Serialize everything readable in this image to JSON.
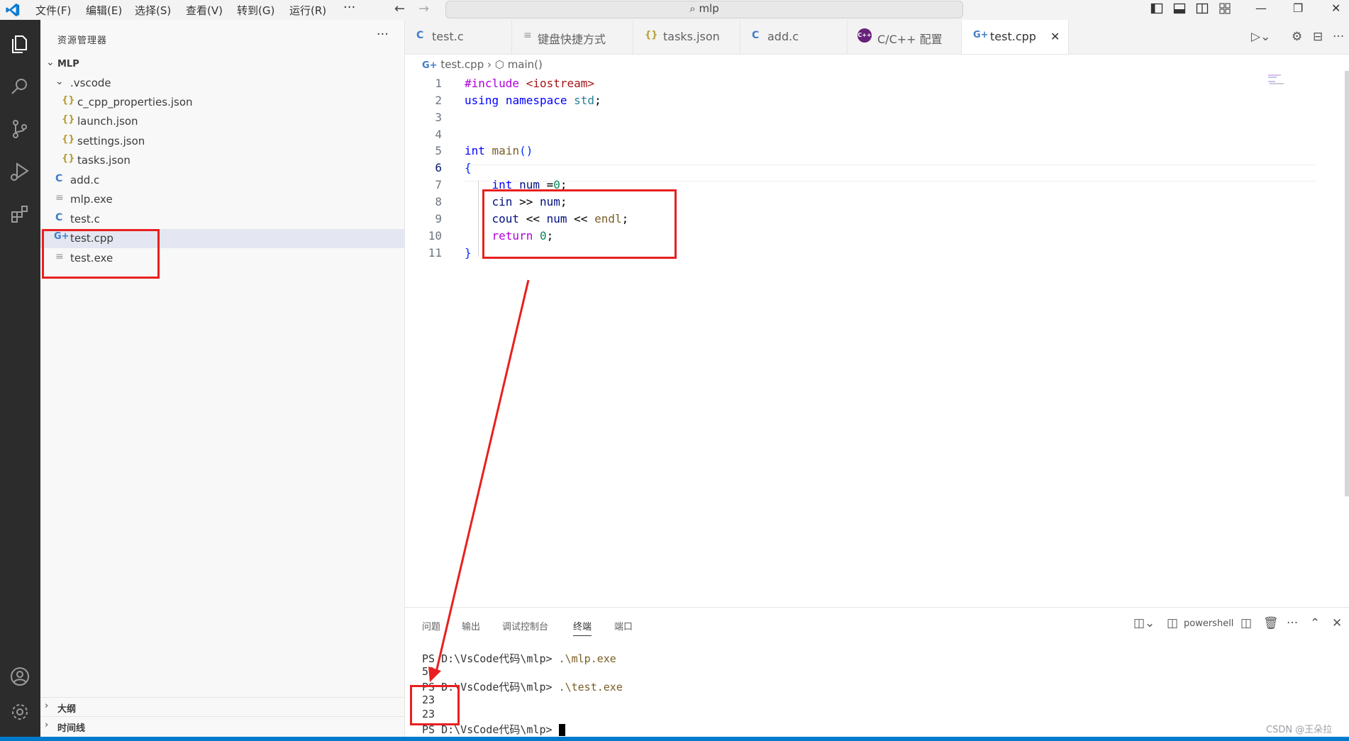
{
  "menu": {
    "items": [
      "文件(F)",
      "编辑(E)",
      "选择(S)",
      "查看(V)",
      "转到(G)",
      "运行(R)"
    ],
    "more": "···"
  },
  "command_center": {
    "text": "mlp",
    "icon": "search-icon"
  },
  "sidebar": {
    "title": "资源管理器",
    "more": "···",
    "root": "MLP",
    "folder": ".vscode",
    "files": {
      "c_cpp": "c_cpp_properties.json",
      "launch": "launch.json",
      "settings": "settings.json",
      "tasks": "tasks.json",
      "addc": "add.c",
      "mlpexe": "mlp.exe",
      "testc": "test.c",
      "testcpp": "test.cpp",
      "testexe": "test.exe"
    },
    "outline": "大纲",
    "timeline": "时间线"
  },
  "tabs": {
    "t1": "test.c",
    "t2": "键盘快捷方式",
    "t3": "tasks.json",
    "t4": "add.c",
    "t5": "C/C++ 配置",
    "t6": "test.cpp"
  },
  "breadcrumb": {
    "file": "test.cpp",
    "symbol": "main()"
  },
  "editor": {
    "line_numbers": [
      "1",
      "2",
      "3",
      "4",
      "5",
      "6",
      "7",
      "8",
      "9",
      "10",
      "11"
    ],
    "current_line": 6,
    "code": {
      "l1_directive": "#include",
      "l1_header": "<iostream>",
      "l2_using": "using",
      "l2_namespace": "namespace",
      "l2_std": "std",
      "l5_int": "int",
      "l5_main": "main",
      "l5_parens": "()",
      "l6_brace": "{",
      "l7_int": "int",
      "l7_num": "num",
      "l7_eq": "=",
      "l7_zero": "0",
      "l8_cin": "cin",
      "l8_op": ">>",
      "l8_num": "num",
      "l9_cout": "cout",
      "l9_op1": "<<",
      "l9_num": "num",
      "l9_op2": "<<",
      "l9_endl": "endl",
      "l10_return": "return",
      "l10_zero": "0",
      "l11_brace": "}"
    }
  },
  "panel": {
    "tabs": [
      "问题",
      "输出",
      "调试控制台",
      "终端",
      "端口"
    ],
    "active_tab": "终端",
    "shell": "powershell",
    "terminal": {
      "prompt": "PS D:\\VsCode代码\\mlp>",
      "cmd1": ".\\mlp.exe",
      "out1": "50",
      "cmd2": ".\\test.exe",
      "out2a": "23",
      "out2b": "23"
    }
  },
  "watermark": "CSDN @王朵拉",
  "colors": {
    "accent": "#007acc",
    "annotation": "#e8201f",
    "activity_bar": "#2c2c2c"
  }
}
